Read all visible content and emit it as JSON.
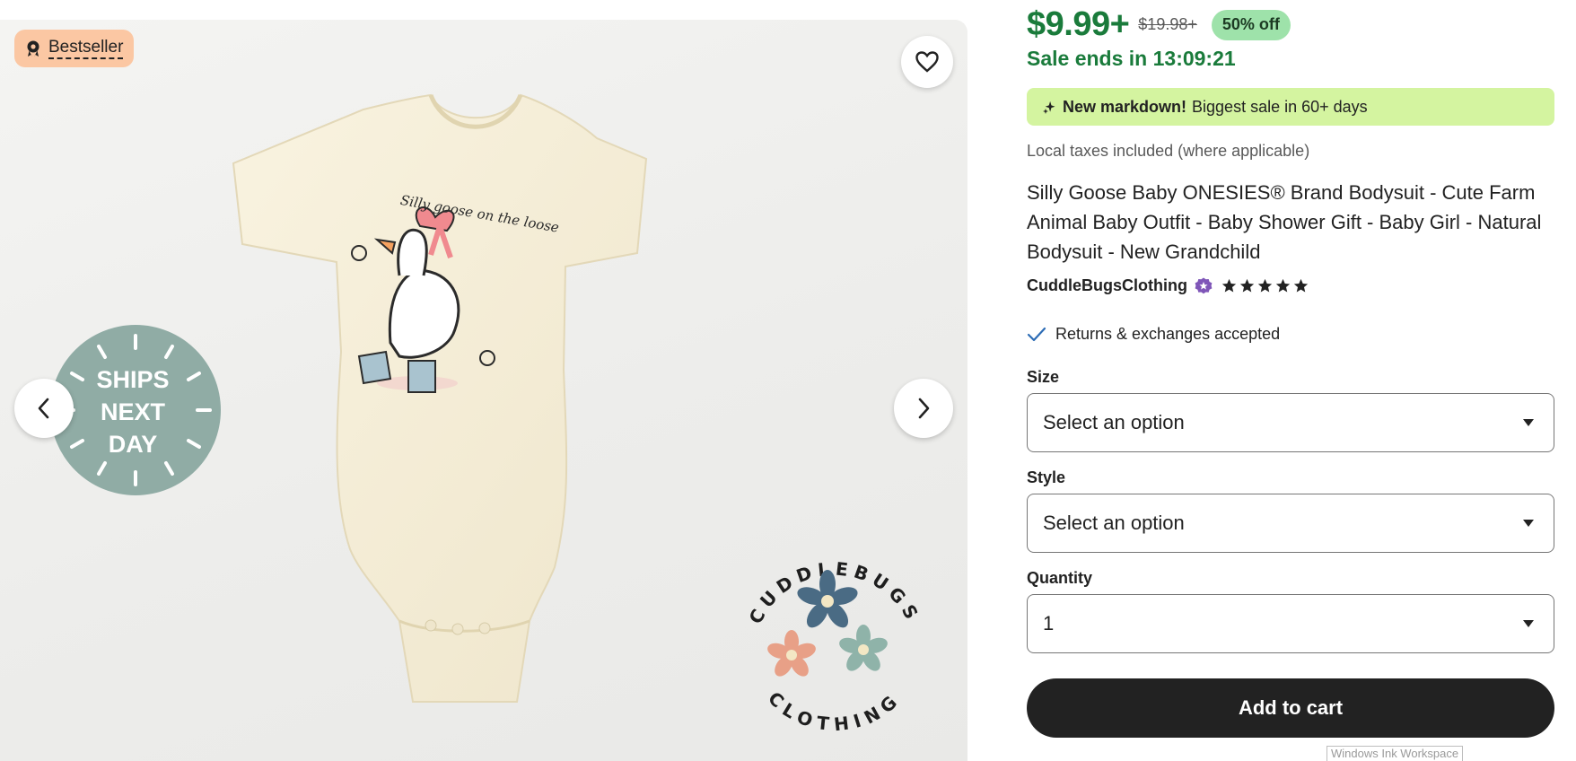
{
  "gallery": {
    "badge_label": "Bestseller",
    "ships_badge_lines": [
      "SHIPS",
      "NEXT",
      "DAY"
    ],
    "brand_logo_top": "CUDDLEBUGS",
    "brand_logo_bottom": "CLOTHING",
    "print_text": "Silly goose on the loose",
    "colors": {
      "onesie": "#f6efd9",
      "ships_badge": "#90aca5",
      "bestseller_badge": "#fbc7a3"
    }
  },
  "pricing": {
    "price": "$9.99+",
    "original_price": "$19.98+",
    "discount": "50% off",
    "sale_ends": "Sale ends in 13:09:21",
    "colors": {
      "price": "#1a7b3b",
      "discount_bg": "#9ee2aa"
    }
  },
  "markdown_banner": {
    "icon": "sparkle-icon",
    "bold_text": "New markdown!",
    "text": "Biggest sale in 60+ days",
    "color": "#d4f4a0"
  },
  "taxes_note": "Local taxes included (where applicable)",
  "product_title": "Silly Goose Baby ONESIES® Brand Bodysuit - Cute Farm Animal Baby Outfit - Baby Shower Gift - Baby Girl - Natural Bodysuit - New Grandchild",
  "shop": {
    "name": "CuddleBugsClothing",
    "star_seller_icon": "star-seller-badge-icon",
    "rating": 5
  },
  "returns": "Returns & exchanges accepted",
  "options": {
    "size_label": "Size",
    "size_value": "Select an option",
    "style_label": "Style",
    "style_value": "Select an option",
    "quantity_label": "Quantity",
    "quantity_value": "1"
  },
  "add_to_cart": "Add to cart",
  "system_tooltip": "Windows Ink Workspace"
}
